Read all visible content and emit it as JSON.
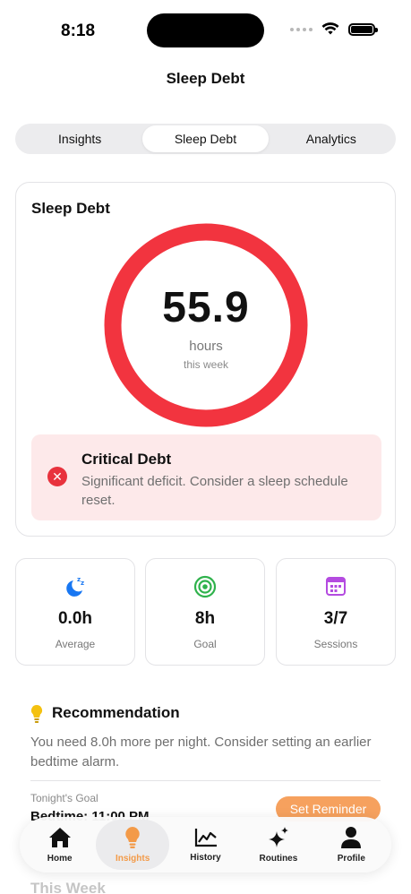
{
  "status_bar": {
    "time": "8:18"
  },
  "header": {
    "title": "Sleep Debt"
  },
  "segments": [
    {
      "label": "Insights"
    },
    {
      "label": "Sleep Debt",
      "active": true
    },
    {
      "label": "Analytics"
    }
  ],
  "debt_card": {
    "title": "Sleep Debt",
    "value": "55.9",
    "unit": "hours",
    "period": "this week",
    "ring_color": "#f2343f",
    "alert": {
      "title": "Critical Debt",
      "message": "Significant deficit. Consider a sleep schedule reset.",
      "icon": "x-circle-icon",
      "color": "#e8323d"
    }
  },
  "stats": [
    {
      "icon": "moon-zzz-icon",
      "value": "0.0h",
      "label": "Average",
      "color": "#1877f2"
    },
    {
      "icon": "target-icon",
      "value": "8h",
      "label": "Goal",
      "color": "#2fb24c"
    },
    {
      "icon": "calendar-icon",
      "value": "3/7",
      "label": "Sessions",
      "color": "#b44be0"
    }
  ],
  "recommendation": {
    "title": "Recommendation",
    "icon": "lightbulb-icon",
    "text": "You need 8.0h more per night. Consider setting an earlier bedtime alarm.",
    "goal_label": "Tonight's Goal",
    "goal_value": "Bedtime: 11:00 PM",
    "button": "Set Reminder"
  },
  "section_next": {
    "title": "This Week"
  },
  "tabbar": [
    {
      "label": "Home",
      "icon": "house-icon"
    },
    {
      "label": "Insights",
      "icon": "lightbulb-icon",
      "active": true
    },
    {
      "label": "History",
      "icon": "chart-line-icon"
    },
    {
      "label": "Routines",
      "icon": "sparkles-icon"
    },
    {
      "label": "Profile",
      "icon": "person-icon"
    }
  ],
  "colors": {
    "accent": "#f39a48",
    "critical": "#f2343f",
    "alert_bg": "#fde9ea"
  }
}
